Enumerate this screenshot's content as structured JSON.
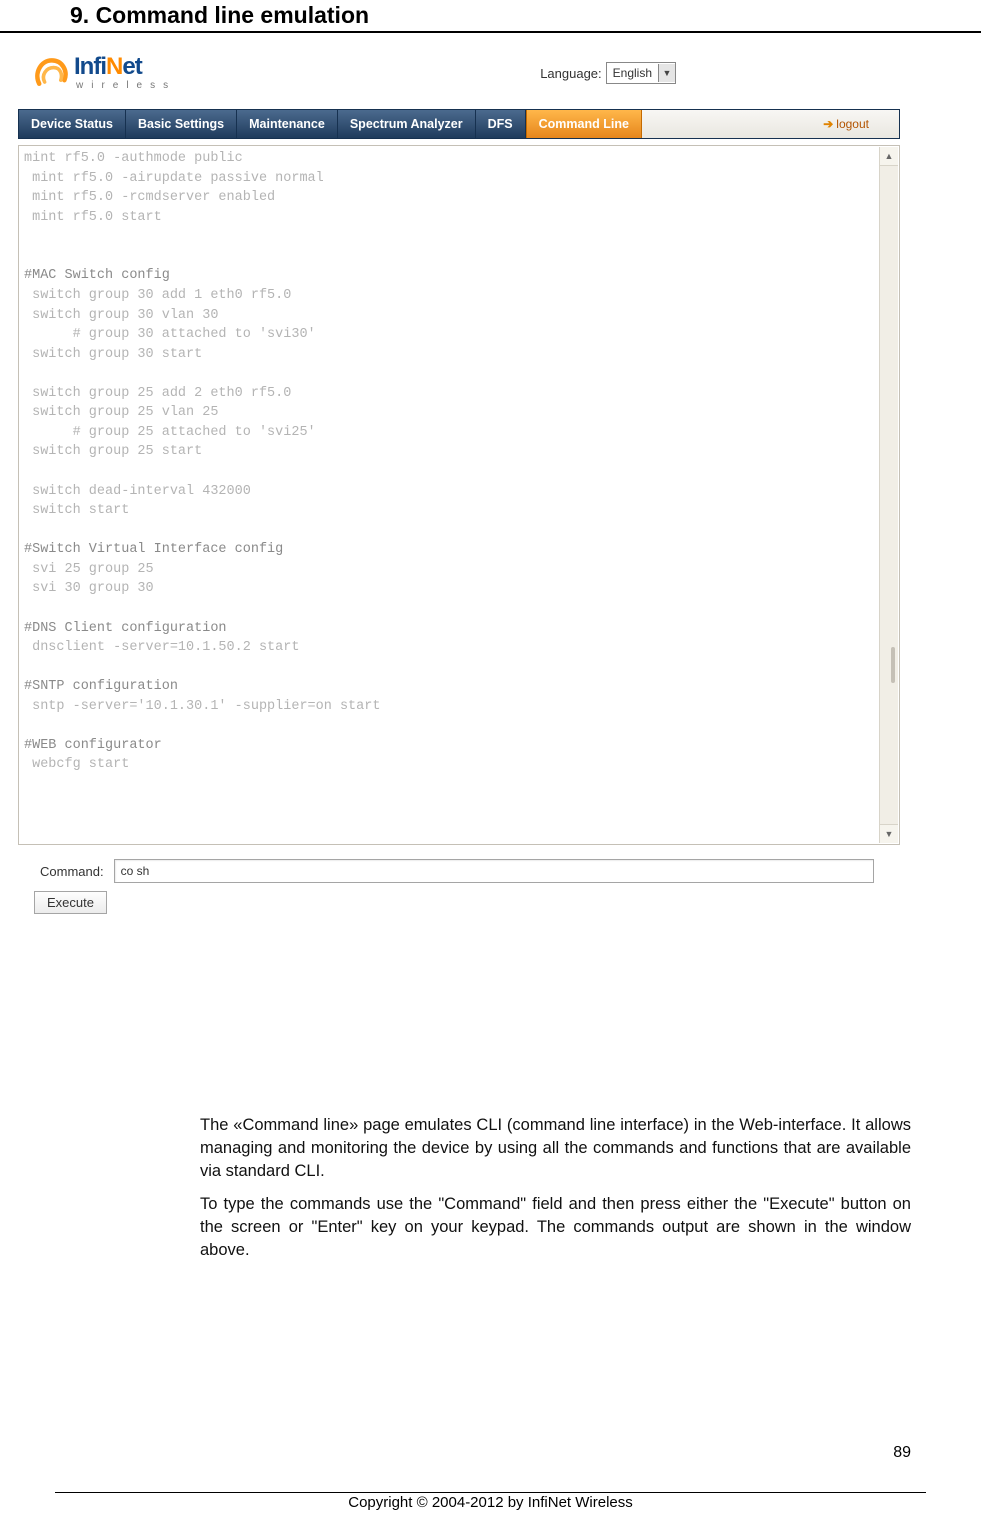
{
  "doc": {
    "heading": "9. Command line emulation",
    "page_number": "89",
    "copyright": "Copyright © 2004-2012 by InfiNet Wireless",
    "paragraph1": " The «Command line» page emulates CLI (command line interface) in the Web-interface. It allows managing and monitoring the device by using all the commands and functions that are available via standard CLI.",
    "paragraph2": "To type the commands use the \"Command\" field and then press either the \"Execute\" button on the screen or \"Enter\" key on your keypad. The commands output are shown in the window above."
  },
  "app": {
    "logo_top": "InfiNet",
    "logo_sub": "wireless",
    "language_label": "Language:",
    "language_value": "English",
    "tabs": {
      "t0": "Device Status",
      "t1": "Basic Settings",
      "t2": "Maintenance",
      "t3": "Spectrum Analyzer",
      "t4": "DFS",
      "t5": "Command Line"
    },
    "logout": "logout",
    "command_label": "Command:",
    "command_value": "co sh",
    "execute_label": "Execute"
  },
  "console": {
    "l0": "mint rf5.0 -authmode public",
    "l1": " mint rf5.0 -airupdate passive normal",
    "l2": " mint rf5.0 -rcmdserver enabled",
    "l3": " mint rf5.0 start",
    "blank0": " ",
    "blank1": " ",
    "c0": "#MAC Switch config",
    "l4": " switch group 30 add 1 eth0 rf5.0",
    "l5": " switch group 30 vlan 30",
    "l6": "      # group 30 attached to 'svi30'",
    "l7": " switch group 30 start",
    "blank2": " ",
    "l8": " switch group 25 add 2 eth0 rf5.0",
    "l9": " switch group 25 vlan 25",
    "l10": "      # group 25 attached to 'svi25'",
    "l11": " switch group 25 start",
    "blank3": " ",
    "l12": " switch dead-interval 432000",
    "l13": " switch start",
    "blank4": " ",
    "c1": "#Switch Virtual Interface config",
    "l14": " svi 25 group 25",
    "l15": " svi 30 group 30",
    "blank5": " ",
    "c2": "#DNS Client configuration",
    "l16": " dnsclient -server=10.1.50.2 start",
    "blank6": " ",
    "c3": "#SNTP configuration",
    "l17": " sntp -server='10.1.30.1' -supplier=on start",
    "blank7": " ",
    "c4": "#WEB configurator",
    "l18": " webcfg start"
  }
}
